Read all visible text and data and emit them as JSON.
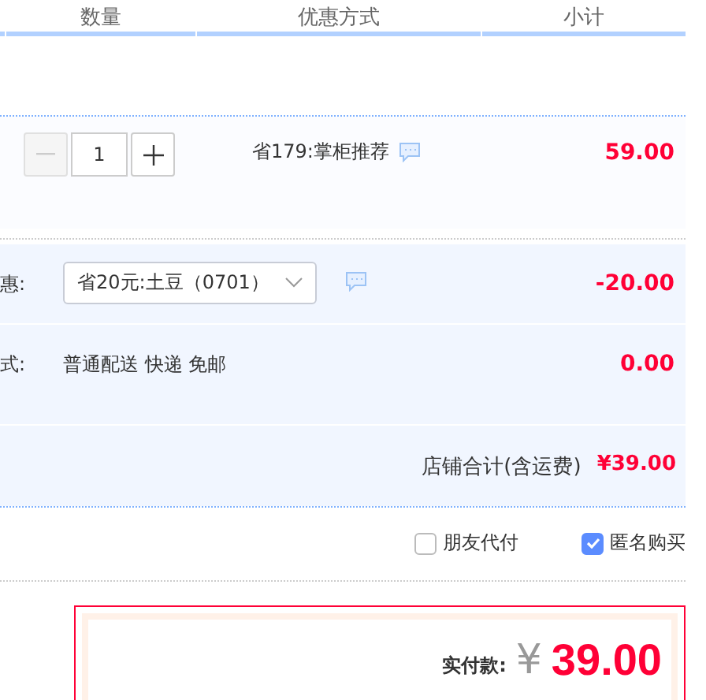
{
  "columns": [
    "数量",
    "优惠方式",
    "小计"
  ],
  "item": {
    "minus_disabled": true,
    "quantity": "1",
    "promotion": "省179:掌柜推荐",
    "subtotal": "59.00"
  },
  "coupon": {
    "label": "惠:",
    "value": "省20元:土豆（0701）",
    "amount": "-20.00"
  },
  "shipping": {
    "label": "式:",
    "value": "普通配送 快递 免邮",
    "amount": "0.00"
  },
  "shop_total": {
    "label": "店铺合计(含运费)",
    "amount": "¥39.00"
  },
  "options": [
    {
      "label": "朋友代付",
      "checked": false
    },
    {
      "label": "匿名购买",
      "checked": true
    }
  ],
  "payment": {
    "label": "实付款:",
    "currency": "¥",
    "amount": "39.00"
  }
}
